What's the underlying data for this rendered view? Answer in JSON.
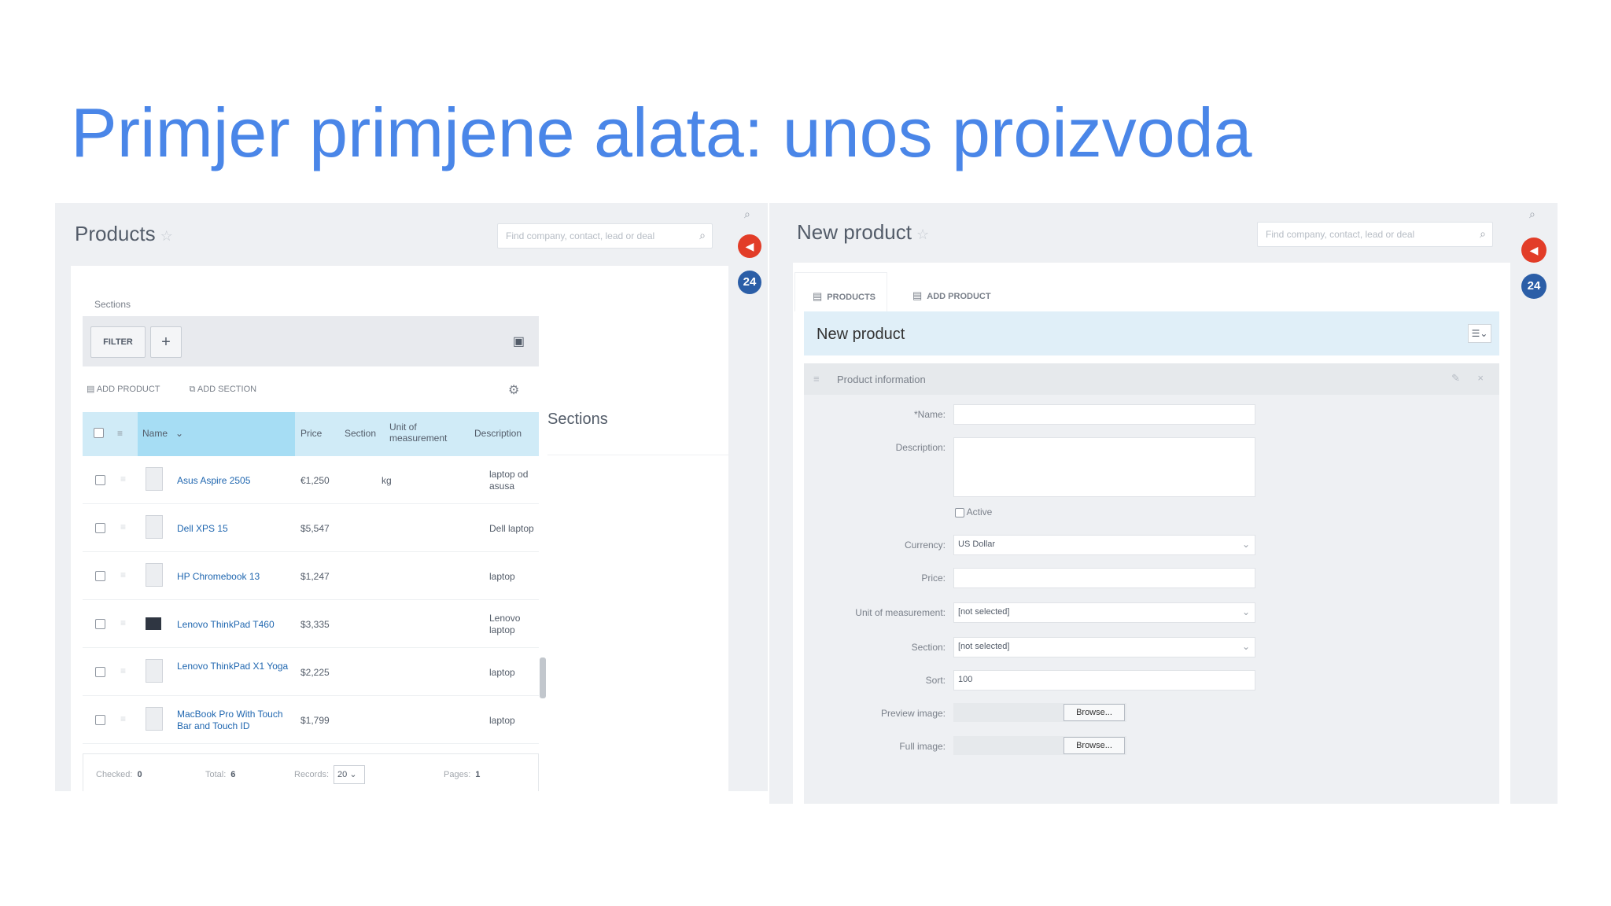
{
  "slide": {
    "title": "Primjer primjene alata: unos proizvoda"
  },
  "left": {
    "title": "Products",
    "search_placeholder": "Find company, contact, lead or deal",
    "sections_label": "Sections",
    "filter_label": "FILTER",
    "add_label": "+",
    "actions": {
      "add_product": "ADD PRODUCT",
      "add_section": "ADD SECTION"
    },
    "columns": {
      "name": "Name",
      "price": "Price",
      "section": "Section",
      "unit": "Unit of measurement",
      "description": "Description"
    },
    "rows": [
      {
        "name": "Asus Aspire 2505",
        "price": "€1,250",
        "unit": "kg",
        "description": "laptop od asusa"
      },
      {
        "name": "Dell XPS 15",
        "price": "$5,547",
        "unit": "",
        "description": "Dell laptop"
      },
      {
        "name": "HP Chromebook 13",
        "price": "$1,247",
        "unit": "",
        "description": "laptop"
      },
      {
        "name": "Lenovo ThinkPad T460",
        "price": "$3,335",
        "unit": "",
        "description": "Lenovo laptop"
      },
      {
        "name": "Lenovo ThinkPad X1 Yoga",
        "price": "$2,225",
        "unit": "",
        "description": "laptop"
      },
      {
        "name": "MacBook Pro With Touch Bar and Touch ID",
        "price": "$1,799",
        "unit": "",
        "description": "laptop"
      }
    ],
    "footer": {
      "checked_label": "Checked:",
      "checked": "0",
      "total_label": "Total:",
      "total": "6",
      "records_label": "Records:",
      "records": "20",
      "pages_label": "Pages:",
      "pages": "1"
    },
    "sections_panel_title": "Sections",
    "badge_24": "24"
  },
  "right": {
    "title": "New product",
    "search_placeholder": "Find company, contact, lead or deal",
    "tabs": [
      "PRODUCTS",
      "ADD PRODUCT"
    ],
    "form_title": "New product",
    "section_title": "Product information",
    "fields": {
      "name_label": "*Name:",
      "description_label": "Description:",
      "active_label": "Active",
      "currency_label": "Currency:",
      "currency_value": "US Dollar",
      "price_label": "Price:",
      "unit_label": "Unit of measurement:",
      "unit_value": "[not selected]",
      "section_label": "Section:",
      "section_value": "[not selected]",
      "sort_label": "Sort:",
      "sort_value": "100",
      "preview_label": "Preview image:",
      "full_label": "Full image:",
      "browse": "Browse..."
    },
    "badge_24": "24"
  },
  "colors": {
    "title_blue": "#4a86e8",
    "header_blue": "#d0ebf7",
    "badge_red": "#e23d28",
    "badge_blue": "#2b5ea7"
  }
}
